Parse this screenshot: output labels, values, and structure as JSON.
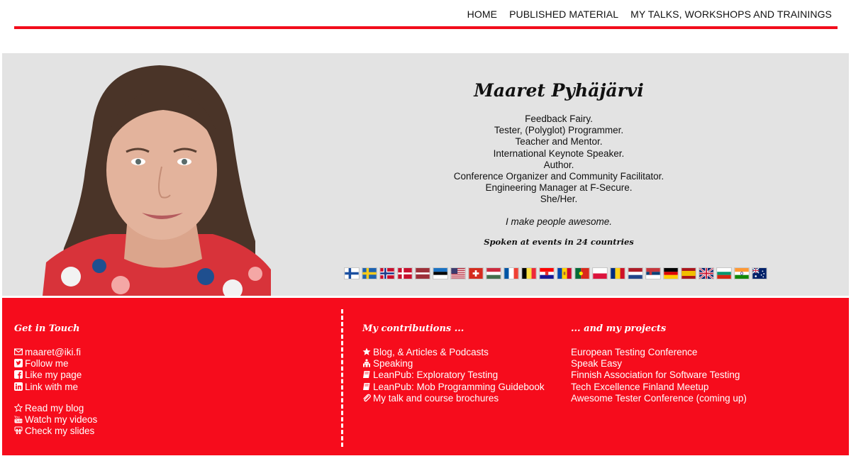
{
  "nav": {
    "items": [
      "HOME",
      "PUBLISHED MATERIAL",
      "MY TALKS, WORKSHOPS AND TRAININGS"
    ]
  },
  "hero": {
    "name": "Maaret Pyhäjärvi",
    "taglines": [
      "Feedback Fairy.",
      "Tester, (Polyglot) Programmer.",
      "Teacher and Mentor.",
      "International Keynote Speaker.",
      "Author.",
      "Conference Organizer and Community Facilitator.",
      "Engineering Manager at F-Secure.",
      "She/Her."
    ],
    "motto": "I make people awesome.",
    "countries_heading": "Spoken at events in 24 countries",
    "flags": [
      "finland",
      "sweden",
      "norway",
      "denmark",
      "latvia",
      "estonia",
      "usa",
      "switzerland",
      "hungary",
      "france",
      "belgium",
      "croatia",
      "moldova",
      "portugal",
      "poland",
      "romania",
      "netherlands",
      "serbia",
      "germany",
      "spain",
      "united-kingdom",
      "bulgaria",
      "india",
      "australia"
    ]
  },
  "footer": {
    "get_in_touch": {
      "heading": "Get in Touch",
      "items": [
        {
          "icon": "envelope-icon",
          "label": "maaret@iki.fi"
        },
        {
          "icon": "twitter-icon",
          "label": "Follow me"
        },
        {
          "icon": "facebook-icon",
          "label": "Like my page"
        },
        {
          "icon": "linkedin-icon",
          "label": "Link with me"
        }
      ],
      "items2": [
        {
          "icon": "star-outline-icon",
          "label": "Read my blog"
        },
        {
          "icon": "youtube-icon",
          "label": "Watch my videos"
        },
        {
          "icon": "slideshare-icon",
          "label": "Check my slides"
        }
      ]
    },
    "contributions": {
      "heading": "My contributions ...",
      "items": [
        {
          "icon": "star-icon",
          "label": "Blog, & Articles & Podcasts"
        },
        {
          "icon": "podium-icon",
          "label": "Speaking"
        },
        {
          "icon": "book-icon",
          "label": "LeanPub: Exploratory Testing"
        },
        {
          "icon": "book-icon",
          "label": "LeanPub: Mob Programming Guidebook"
        },
        {
          "icon": "paperclip-icon",
          "label": "My talk and course brochures"
        }
      ]
    },
    "projects": {
      "heading": "... and my projects",
      "items": [
        "European Testing Conference",
        "Speak Easy",
        "Finnish Association for Software Testing",
        "Tech Excellence Finland Meetup",
        "Awesome Tester Conference (coming up)"
      ]
    }
  },
  "colors": {
    "accent_red": "#f60c1c",
    "hero_bg": "#e3e3e3"
  }
}
